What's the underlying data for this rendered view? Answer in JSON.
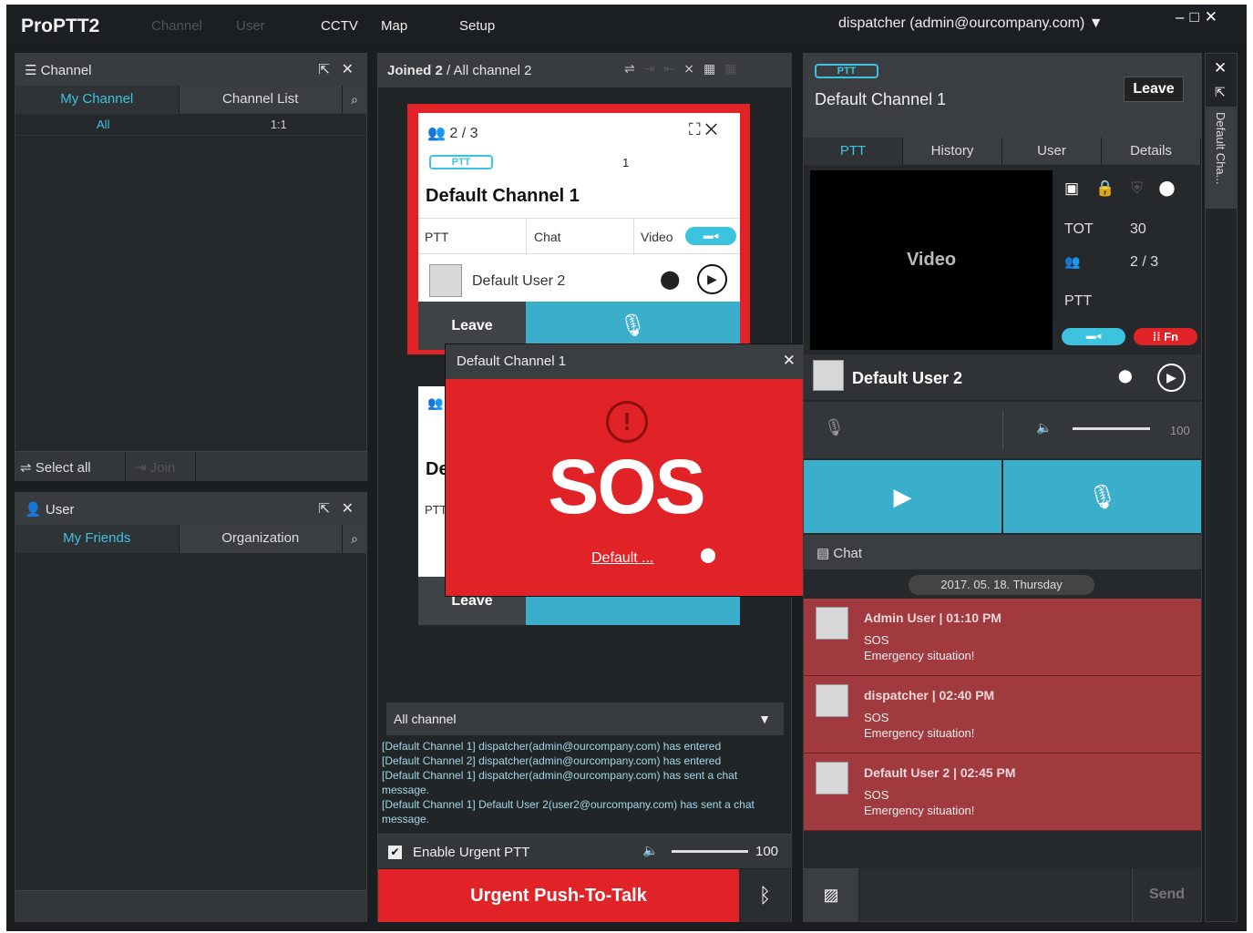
{
  "app": {
    "title": "ProPTT2",
    "menu": [
      "Channel",
      "User",
      "CCTV",
      "Map",
      "Setup"
    ],
    "account": "dispatcher (admin@ourcompany.com)"
  },
  "channel_panel": {
    "title": "Channel",
    "tabs": [
      "My Channel",
      "Channel List"
    ],
    "row": {
      "name": "All",
      "count": "1:1"
    },
    "select_all": "Select all",
    "join": "Join"
  },
  "user_panel": {
    "title": "User",
    "tabs": [
      "My Friends",
      "Organization"
    ]
  },
  "center": {
    "joined": "Joined 2",
    "all_channel": "/ All channel 2",
    "card1": {
      "members": "2 / 3",
      "badge": "PTT",
      "count": "1",
      "name": "Default Channel 1",
      "cols": [
        "PTT",
        "Chat",
        "Video"
      ],
      "user": "Default User 2",
      "leave": "Leave"
    },
    "card2": {
      "name": "De",
      "col": "PTT",
      "leave": "Leave"
    },
    "filter": "All channel",
    "log": [
      "[Default Channel 1] dispatcher(admin@ourcompany.com) has entered",
      "[Default Channel 2] dispatcher(admin@ourcompany.com) has entered",
      "[Default Channel 1] dispatcher(admin@ourcompany.com) has sent a chat message.",
      "[Default Channel 1] Default User 2(user2@ourcompany.com) has sent a chat message."
    ],
    "urgent_enable": "Enable Urgent PTT",
    "volume": "100",
    "urgent_btn": "Urgent Push-To-Talk"
  },
  "sos": {
    "title": "Default Channel 1",
    "text": "SOS",
    "user_link": "Default ..."
  },
  "right": {
    "badge": "PTT",
    "channel": "Default Channel 1",
    "leave": "Leave",
    "tabs": [
      "PTT",
      "History",
      "User",
      "Details"
    ],
    "video": "Video",
    "tot_label": "TOT",
    "tot_value": "30",
    "members": "2 / 3",
    "ptt_label": "PTT",
    "fn": "Fn",
    "user": "Default User 2",
    "volume": "100",
    "chat_title": "Chat",
    "date": "2017. 05. 18. Thursday",
    "messages": [
      {
        "head": "Admin User | 01:10 PM",
        "line1": "SOS",
        "line2": "Emergency situation!"
      },
      {
        "head": "dispatcher | 02:40 PM",
        "line1": "SOS",
        "line2": "Emergency situation!"
      },
      {
        "head": "Default User 2 | 02:45 PM",
        "line1": "SOS",
        "line2": "Emergency situation!"
      }
    ],
    "send": "Send",
    "side_tab": "Default Cha..."
  }
}
